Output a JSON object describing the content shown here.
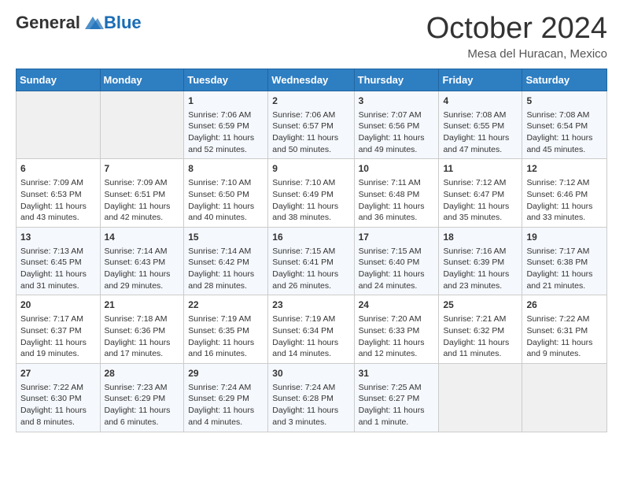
{
  "header": {
    "logo_general": "General",
    "logo_blue": "Blue",
    "month_title": "October 2024",
    "location": "Mesa del Huracan, Mexico"
  },
  "weekdays": [
    "Sunday",
    "Monday",
    "Tuesday",
    "Wednesday",
    "Thursday",
    "Friday",
    "Saturday"
  ],
  "weeks": [
    [
      {
        "day": "",
        "content": ""
      },
      {
        "day": "",
        "content": ""
      },
      {
        "day": "1",
        "content": "Sunrise: 7:06 AM\nSunset: 6:59 PM\nDaylight: 11 hours\nand 52 minutes."
      },
      {
        "day": "2",
        "content": "Sunrise: 7:06 AM\nSunset: 6:57 PM\nDaylight: 11 hours\nand 50 minutes."
      },
      {
        "day": "3",
        "content": "Sunrise: 7:07 AM\nSunset: 6:56 PM\nDaylight: 11 hours\nand 49 minutes."
      },
      {
        "day": "4",
        "content": "Sunrise: 7:08 AM\nSunset: 6:55 PM\nDaylight: 11 hours\nand 47 minutes."
      },
      {
        "day": "5",
        "content": "Sunrise: 7:08 AM\nSunset: 6:54 PM\nDaylight: 11 hours\nand 45 minutes."
      }
    ],
    [
      {
        "day": "6",
        "content": "Sunrise: 7:09 AM\nSunset: 6:53 PM\nDaylight: 11 hours\nand 43 minutes."
      },
      {
        "day": "7",
        "content": "Sunrise: 7:09 AM\nSunset: 6:51 PM\nDaylight: 11 hours\nand 42 minutes."
      },
      {
        "day": "8",
        "content": "Sunrise: 7:10 AM\nSunset: 6:50 PM\nDaylight: 11 hours\nand 40 minutes."
      },
      {
        "day": "9",
        "content": "Sunrise: 7:10 AM\nSunset: 6:49 PM\nDaylight: 11 hours\nand 38 minutes."
      },
      {
        "day": "10",
        "content": "Sunrise: 7:11 AM\nSunset: 6:48 PM\nDaylight: 11 hours\nand 36 minutes."
      },
      {
        "day": "11",
        "content": "Sunrise: 7:12 AM\nSunset: 6:47 PM\nDaylight: 11 hours\nand 35 minutes."
      },
      {
        "day": "12",
        "content": "Sunrise: 7:12 AM\nSunset: 6:46 PM\nDaylight: 11 hours\nand 33 minutes."
      }
    ],
    [
      {
        "day": "13",
        "content": "Sunrise: 7:13 AM\nSunset: 6:45 PM\nDaylight: 11 hours\nand 31 minutes."
      },
      {
        "day": "14",
        "content": "Sunrise: 7:14 AM\nSunset: 6:43 PM\nDaylight: 11 hours\nand 29 minutes."
      },
      {
        "day": "15",
        "content": "Sunrise: 7:14 AM\nSunset: 6:42 PM\nDaylight: 11 hours\nand 28 minutes."
      },
      {
        "day": "16",
        "content": "Sunrise: 7:15 AM\nSunset: 6:41 PM\nDaylight: 11 hours\nand 26 minutes."
      },
      {
        "day": "17",
        "content": "Sunrise: 7:15 AM\nSunset: 6:40 PM\nDaylight: 11 hours\nand 24 minutes."
      },
      {
        "day": "18",
        "content": "Sunrise: 7:16 AM\nSunset: 6:39 PM\nDaylight: 11 hours\nand 23 minutes."
      },
      {
        "day": "19",
        "content": "Sunrise: 7:17 AM\nSunset: 6:38 PM\nDaylight: 11 hours\nand 21 minutes."
      }
    ],
    [
      {
        "day": "20",
        "content": "Sunrise: 7:17 AM\nSunset: 6:37 PM\nDaylight: 11 hours\nand 19 minutes."
      },
      {
        "day": "21",
        "content": "Sunrise: 7:18 AM\nSunset: 6:36 PM\nDaylight: 11 hours\nand 17 minutes."
      },
      {
        "day": "22",
        "content": "Sunrise: 7:19 AM\nSunset: 6:35 PM\nDaylight: 11 hours\nand 16 minutes."
      },
      {
        "day": "23",
        "content": "Sunrise: 7:19 AM\nSunset: 6:34 PM\nDaylight: 11 hours\nand 14 minutes."
      },
      {
        "day": "24",
        "content": "Sunrise: 7:20 AM\nSunset: 6:33 PM\nDaylight: 11 hours\nand 12 minutes."
      },
      {
        "day": "25",
        "content": "Sunrise: 7:21 AM\nSunset: 6:32 PM\nDaylight: 11 hours\nand 11 minutes."
      },
      {
        "day": "26",
        "content": "Sunrise: 7:22 AM\nSunset: 6:31 PM\nDaylight: 11 hours\nand 9 minutes."
      }
    ],
    [
      {
        "day": "27",
        "content": "Sunrise: 7:22 AM\nSunset: 6:30 PM\nDaylight: 11 hours\nand 8 minutes."
      },
      {
        "day": "28",
        "content": "Sunrise: 7:23 AM\nSunset: 6:29 PM\nDaylight: 11 hours\nand 6 minutes."
      },
      {
        "day": "29",
        "content": "Sunrise: 7:24 AM\nSunset: 6:29 PM\nDaylight: 11 hours\nand 4 minutes."
      },
      {
        "day": "30",
        "content": "Sunrise: 7:24 AM\nSunset: 6:28 PM\nDaylight: 11 hours\nand 3 minutes."
      },
      {
        "day": "31",
        "content": "Sunrise: 7:25 AM\nSunset: 6:27 PM\nDaylight: 11 hours\nand 1 minute."
      },
      {
        "day": "",
        "content": ""
      },
      {
        "day": "",
        "content": ""
      }
    ]
  ]
}
